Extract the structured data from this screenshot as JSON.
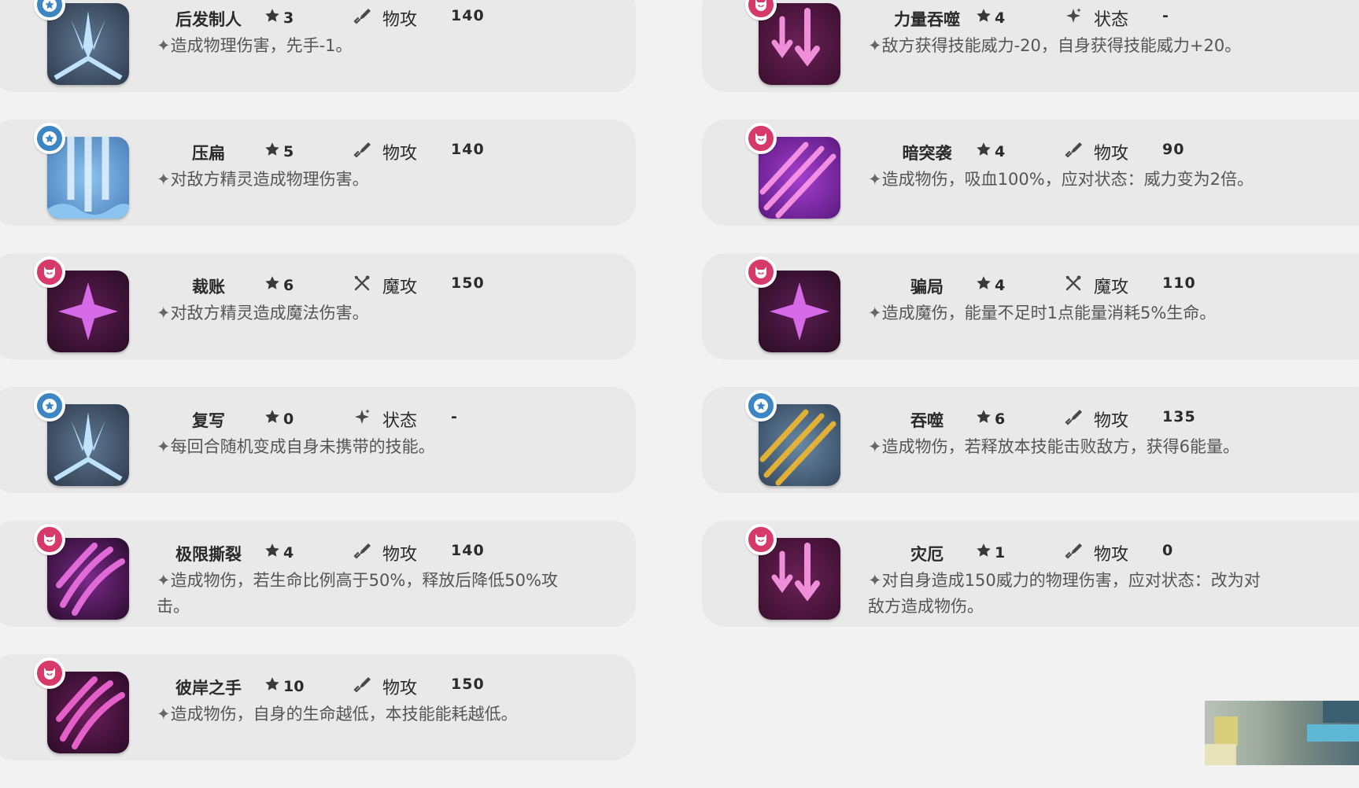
{
  "colors": {
    "page_background": "#f2f2f2",
    "card_background": "#e9e9e9",
    "blue_badge": "#3c86c4",
    "pink_badge": "#d63a6a"
  },
  "skills_left": [
    {
      "name": "后发制人",
      "cost": "3",
      "type_icon": "sword-icon",
      "type": "物攻",
      "power": "140",
      "desc": "造成物理伤害，先手-1。",
      "badge": "blue-star",
      "art": "blue-burst"
    },
    {
      "name": "压扁",
      "cost": "5",
      "type_icon": "sword-icon",
      "type": "物攻",
      "power": "140",
      "desc": "对敌方精灵造成物理伤害。",
      "badge": "blue-star",
      "art": "blue-ice"
    },
    {
      "name": "裁账",
      "cost": "6",
      "type_icon": "magic-cross-icon",
      "type": "魔攻",
      "power": "150",
      "desc": "对敌方精灵造成魔法伤害。",
      "badge": "pink-demon",
      "art": "purple-star"
    },
    {
      "name": "复写",
      "cost": "0",
      "type_icon": "sparkle-icon",
      "type": "状态",
      "power": "-",
      "desc": "每回合随机变成自身未携带的技能。",
      "badge": "blue-star",
      "art": "blue-burst"
    },
    {
      "name": "极限撕裂",
      "cost": "4",
      "type_icon": "sword-icon",
      "type": "物攻",
      "power": "140",
      "desc": "造成物伤，若生命比例高于50%，释放后降低50%攻击。",
      "badge": "pink-demon",
      "art": "pink-claw"
    },
    {
      "name": "彼岸之手",
      "cost": "10",
      "type_icon": "sword-icon",
      "type": "物攻",
      "power": "150",
      "desc": "造成物伤，自身的生命越低，本技能能耗越低。",
      "badge": "pink-demon",
      "art": "purple-claw"
    }
  ],
  "skills_right": [
    {
      "name": "力量吞噬",
      "cost": "4",
      "type_icon": "sparkle-icon",
      "type": "状态",
      "power": "-",
      "desc": "敌方获得技能威力-20，自身获得技能威力+20。",
      "badge": "pink-demon",
      "art": "purple-arrows"
    },
    {
      "name": "暗突袭",
      "cost": "4",
      "type_icon": "sword-icon",
      "type": "物攻",
      "power": "90",
      "desc": "造成物伤，吸血100%，应对状态：威力变为2倍。",
      "badge": "pink-demon",
      "art": "violet-slash"
    },
    {
      "name": "骗局",
      "cost": "4",
      "type_icon": "magic-cross-icon",
      "type": "魔攻",
      "power": "110",
      "desc": "造成魔伤，能量不足时1点能量消耗5%生命。",
      "badge": "pink-demon",
      "art": "purple-star"
    },
    {
      "name": "吞噬",
      "cost": "6",
      "type_icon": "sword-icon",
      "type": "物攻",
      "power": "135",
      "desc": "造成物伤，若释放本技能击败敌方，获得6能量。",
      "badge": "blue-star",
      "art": "blue-slash"
    },
    {
      "name": "灾厄",
      "cost": "1",
      "type_icon": "sword-icon",
      "type": "物攻",
      "power": "0",
      "desc": "对自身造成150威力的物理伤害，应对状态：改为对敌方造成物伤。",
      "badge": "pink-demon",
      "art": "purple-arrows"
    }
  ],
  "desc_bullet": "✦"
}
